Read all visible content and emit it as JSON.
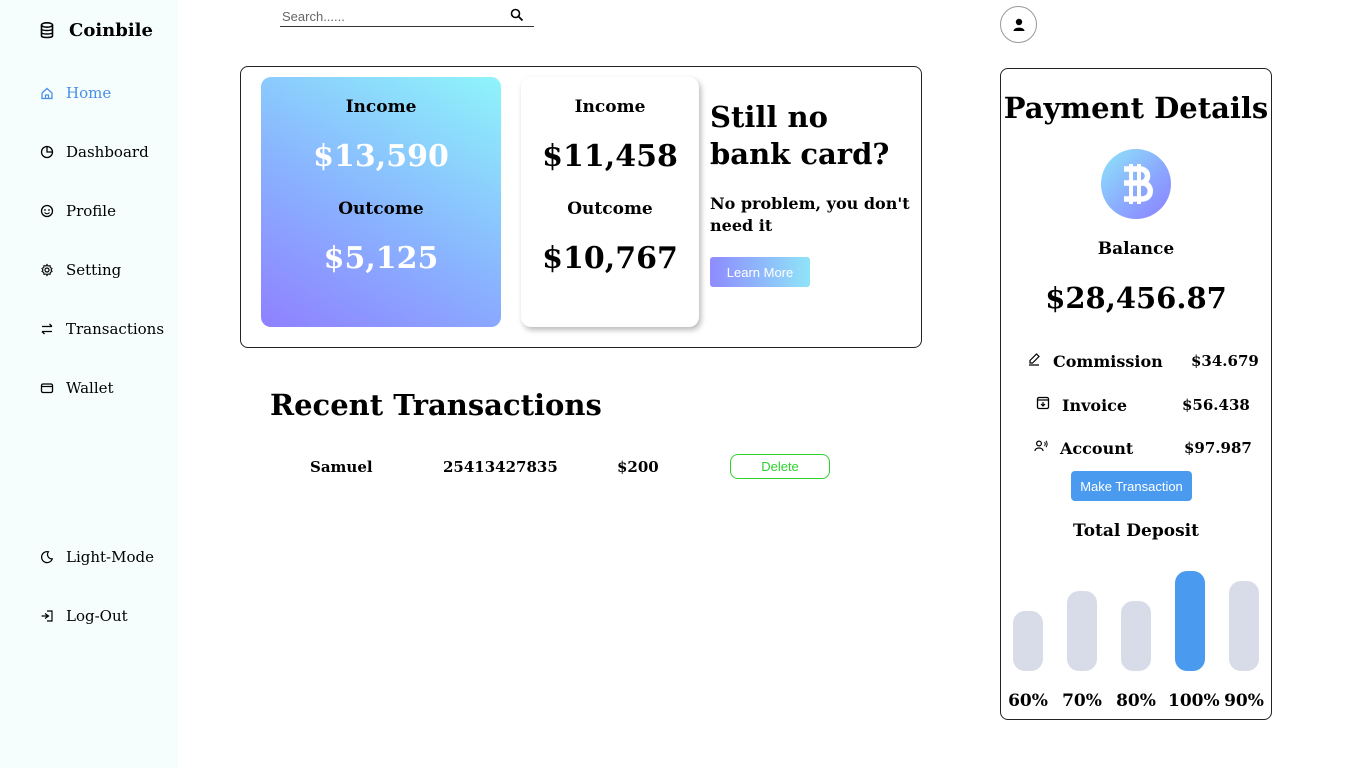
{
  "brand": {
    "name": "Coinbile",
    "icon": "database-icon"
  },
  "sidebar": {
    "items": [
      {
        "label": "Home",
        "icon": "home-icon",
        "active": true
      },
      {
        "label": "Dashboard",
        "icon": "pie-chart-icon"
      },
      {
        "label": "Profile",
        "icon": "profile-icon"
      },
      {
        "label": "Setting",
        "icon": "gear-icon"
      },
      {
        "label": "Transactions",
        "icon": "swap-arrows-icon"
      },
      {
        "label": "Wallet",
        "icon": "wallet-icon"
      }
    ],
    "bottom": [
      {
        "label": "Light-Mode",
        "icon": "moon-icon"
      },
      {
        "label": "Log-Out",
        "icon": "logout-icon"
      }
    ]
  },
  "search": {
    "placeholder": "Search......"
  },
  "cards": [
    {
      "income_label": "Income",
      "income": "$13,590",
      "outcome_label": "Outcome",
      "outcome": "$5,125"
    },
    {
      "income_label": "Income",
      "income": "$11,458",
      "outcome_label": "Outcome",
      "outcome": "$10,767"
    }
  ],
  "promo": {
    "title": "Still no bank card?",
    "text": "No problem, you don't need it",
    "button": "Learn More"
  },
  "transactions": {
    "title": "Recent Transactions",
    "rows": [
      {
        "name": "Samuel",
        "number": "25413427835",
        "amount": "$200",
        "action": "Delete"
      }
    ]
  },
  "payment": {
    "title": "Payment Details",
    "balance_label": "Balance",
    "balance": "$28,456.87",
    "details": [
      {
        "label": "Commission",
        "value": "$34.679",
        "icon": "pencil-icon"
      },
      {
        "label": "Invoice",
        "value": "$56.438",
        "icon": "invoice-icon"
      },
      {
        "label": "Account",
        "value": "$97.987",
        "icon": "account-icon"
      }
    ],
    "button": "Make Transaction",
    "deposit_title": "Total Deposit",
    "deposits": [
      {
        "label": "60%",
        "level": 0.6,
        "highlight": false
      },
      {
        "label": "70%",
        "level": 0.8,
        "highlight": false
      },
      {
        "label": "80%",
        "level": 0.7,
        "highlight": false
      },
      {
        "label": "100%",
        "level": 1.0,
        "highlight": true
      },
      {
        "label": "90%",
        "level": 0.9,
        "highlight": false
      }
    ],
    "colors": {
      "accent": "#4a9bf0",
      "bar": "#d8dce8"
    }
  }
}
